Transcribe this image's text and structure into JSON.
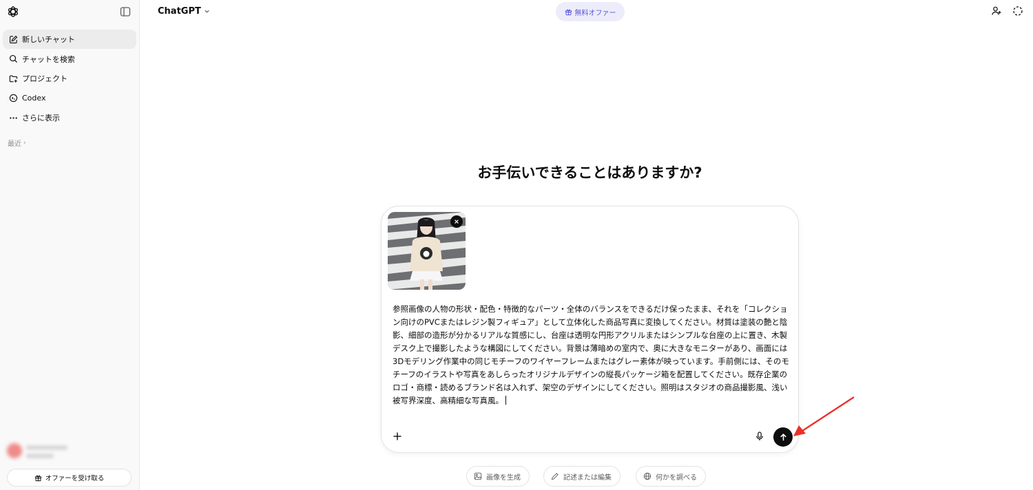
{
  "app": {
    "title": "ChatGPT"
  },
  "header": {
    "free_offer_label": "無料オファー"
  },
  "sidebar": {
    "items": [
      {
        "label": "新しいチャット",
        "icon": "edit-icon"
      },
      {
        "label": "チャットを検索",
        "icon": "search-icon"
      },
      {
        "label": "プロジェクト",
        "icon": "folder-plus-icon"
      },
      {
        "label": "Codex",
        "icon": "codex-icon"
      },
      {
        "label": "さらに表示",
        "icon": "more-icon"
      }
    ],
    "recent_label": "最近",
    "offer_button_label": "オファーを受け取る"
  },
  "main": {
    "heading": "お手伝いできることはありますか?",
    "prompt_text": "参照画像の人物の形状・配色・特徴的なパーツ・全体のバランスをできるだけ保ったまま、それを「コレクション向けのPVCまたはレジン製フィギュア」として立体化した商品写真に変換してください。材質は塗装の艶と陰影、細部の造形が分かるリアルな質感にし、台座は透明な円形アクリルまたはシンプルな台座の上に置き、木製デスク上で撮影したような構図にしてください。背景は薄暗めの室内で、奥に大きなモニターがあり、画面には3Dモデリング作業中の同じモチーフのワイヤーフレームまたはグレー素体が映っています。手前側には、そのモチーフのイラストや写真をあしらったオリジナルデザインの縦長パッケージ箱を配置してください。既存企業のロゴ・商標・読めるブランド名は入れず、架空のデザインにしてください。照明はスタジオの商品撮影風、浅い被写界深度、高精細な写真風。"
  },
  "suggestions": [
    {
      "label": "画像を生成",
      "icon": "image-icon"
    },
    {
      "label": "記述または編集",
      "icon": "pencil-icon"
    },
    {
      "label": "何かを調べる",
      "icon": "globe-icon"
    }
  ],
  "colors": {
    "accent": "#5856d6",
    "offer_bg": "#ececfb",
    "send_button": "#0d0d0d",
    "annotation_arrow": "#e8322b"
  }
}
